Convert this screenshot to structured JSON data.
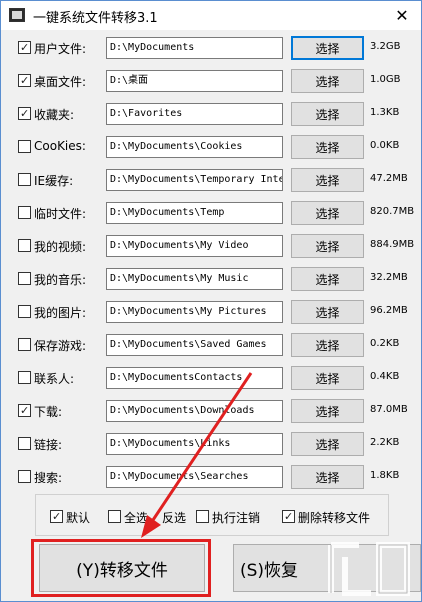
{
  "window": {
    "title": "一键系统文件转移3.1",
    "close_glyph": "✕"
  },
  "rows": [
    {
      "label": "用户文件:",
      "checked": true,
      "path": "D:\\MyDocuments",
      "button": "选择",
      "size": "3.2GB"
    },
    {
      "label": "桌面文件:",
      "checked": true,
      "path": "D:\\桌面",
      "button": "选择",
      "size": "1.0GB"
    },
    {
      "label": "收藏夹:",
      "checked": true,
      "path": "D:\\Favorites",
      "button": "选择",
      "size": "1.3KB"
    },
    {
      "label": "CooKies:",
      "checked": false,
      "path": "D:\\MyDocuments\\Cookies",
      "button": "选择",
      "size": "0.0KB"
    },
    {
      "label": "IE缓存:",
      "checked": false,
      "path": "D:\\MyDocuments\\Temporary Inte",
      "button": "选择",
      "size": "47.2MB"
    },
    {
      "label": "临时文件:",
      "checked": false,
      "path": "D:\\MyDocuments\\Temp",
      "button": "选择",
      "size": "820.7MB"
    },
    {
      "label": "我的视频:",
      "checked": false,
      "path": "D:\\MyDocuments\\My Video",
      "button": "选择",
      "size": "884.9MB"
    },
    {
      "label": "我的音乐:",
      "checked": false,
      "path": "D:\\MyDocuments\\My Music",
      "button": "选择",
      "size": "32.2MB"
    },
    {
      "label": "我的图片:",
      "checked": false,
      "path": "D:\\MyDocuments\\My Pictures",
      "button": "选择",
      "size": "96.2MB"
    },
    {
      "label": "保存游戏:",
      "checked": false,
      "path": "D:\\MyDocuments\\Saved Games",
      "button": "选择",
      "size": "0.2KB"
    },
    {
      "label": "联系人:",
      "checked": false,
      "path": "D:\\MyDocumentsContacts",
      "button": "选择",
      "size": "0.4KB"
    },
    {
      "label": "下载:",
      "checked": true,
      "path": "D:\\MyDocuments\\Downloads",
      "button": "选择",
      "size": "87.0MB"
    },
    {
      "label": "链接:",
      "checked": false,
      "path": "D:\\MyDocuments\\Links",
      "button": "选择",
      "size": "2.2KB"
    },
    {
      "label": "搜索:",
      "checked": false,
      "path": "D:\\MyDocuments\\Searches",
      "button": "选择",
      "size": "1.8KB"
    }
  ],
  "options": [
    {
      "label": "默认",
      "checked": true
    },
    {
      "label": "全选",
      "checked": false
    },
    {
      "label": "反选",
      "checked": false
    },
    {
      "label": "执行注销",
      "checked": false
    },
    {
      "label": "删除转移文件",
      "checked": true
    }
  ],
  "actions": {
    "transfer_label": "(Y)转移文件",
    "restore_label": "(S)恢复"
  },
  "colors": {
    "highlight": "#e02020",
    "focus": "#0078d7"
  }
}
